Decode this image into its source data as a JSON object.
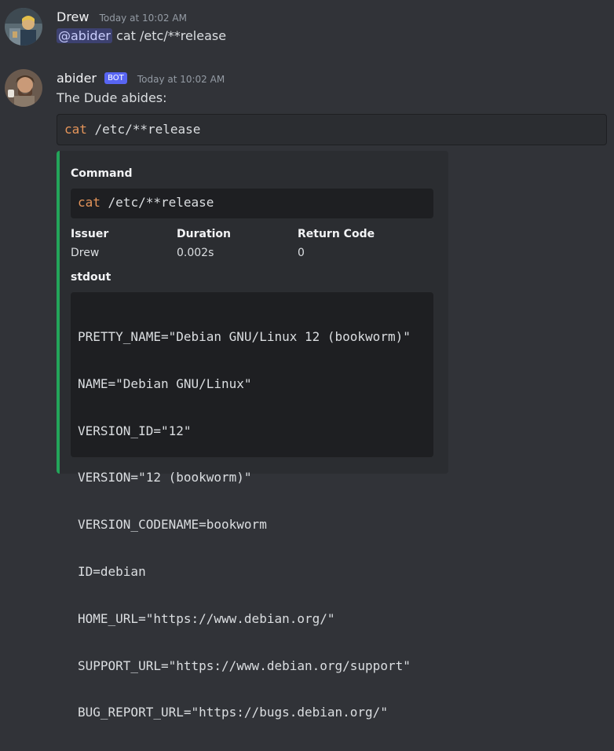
{
  "messages": [
    {
      "username": "Drew",
      "timestamp": "Today at 10:02 AM",
      "mention": "@abider",
      "text": " cat /etc/**release"
    },
    {
      "username": "abider",
      "bot_tag": "BOT",
      "timestamp": "Today at 10:02 AM",
      "text": "The Dude abides:",
      "code": {
        "keyword": "cat",
        "rest": " /etc/**release"
      },
      "embed": {
        "accent_color": "#23a55a",
        "command_label": "Command",
        "command": {
          "keyword": "cat",
          "rest": " /etc/**release"
        },
        "fields": [
          {
            "name": "Issuer",
            "value": "Drew"
          },
          {
            "name": "Duration",
            "value": "0.002s"
          },
          {
            "name": "Return Code",
            "value": "0"
          }
        ],
        "stdout_label": "stdout",
        "stdout_lines": [
          "PRETTY_NAME=\"Debian GNU/Linux 12 (bookworm)\"",
          "NAME=\"Debian GNU/Linux\"",
          "VERSION_ID=\"12\"",
          "VERSION=\"12 (bookworm)\"",
          "VERSION_CODENAME=bookworm",
          "ID=debian",
          "HOME_URL=\"https://www.debian.org/\"",
          "SUPPORT_URL=\"https://www.debian.org/support\"",
          "BUG_REPORT_URL=\"https://bugs.debian.org/\""
        ]
      }
    }
  ],
  "colors": {
    "background": "#313338",
    "mention_bg": "#3c4270",
    "bot_tag": "#5865f2",
    "code_keyword": "#e5955a"
  }
}
